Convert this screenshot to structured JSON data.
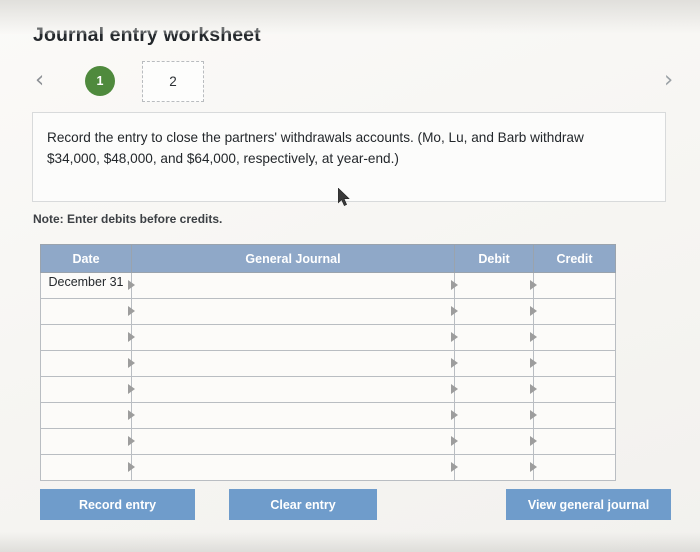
{
  "worksheet": {
    "title": "Journal entry worksheet",
    "nav": {
      "prev_icon": "chevron-left-icon",
      "next_icon": "chevron-right-icon",
      "steps": [
        {
          "label": "1",
          "state": "completed"
        },
        {
          "label": "2",
          "state": "active"
        }
      ]
    },
    "instruction": "Record the entry to close the partners' withdrawals accounts. (Mo, Lu, and Barb withdraw $34,000, $48,000, and $64,000, respectively, at year-end.)",
    "note": "Note: Enter debits before credits."
  },
  "table": {
    "headers": [
      "Date",
      "General Journal",
      "Debit",
      "Credit"
    ],
    "rows": [
      {
        "date": "December 31",
        "account": "",
        "debit": "",
        "credit": ""
      },
      {
        "date": "",
        "account": "",
        "debit": "",
        "credit": ""
      },
      {
        "date": "",
        "account": "",
        "debit": "",
        "credit": ""
      },
      {
        "date": "",
        "account": "",
        "debit": "",
        "credit": ""
      },
      {
        "date": "",
        "account": "",
        "debit": "",
        "credit": ""
      },
      {
        "date": "",
        "account": "",
        "debit": "",
        "credit": ""
      },
      {
        "date": "",
        "account": "",
        "debit": "",
        "credit": ""
      },
      {
        "date": "",
        "account": "",
        "debit": "",
        "credit": ""
      }
    ]
  },
  "buttons": {
    "record": "Record entry",
    "clear": "Clear entry",
    "view": "View general journal"
  },
  "colors": {
    "header_blue": "#8fa8c8",
    "button_blue": "#6f9ccb",
    "step_green": "#4f8a3d"
  }
}
